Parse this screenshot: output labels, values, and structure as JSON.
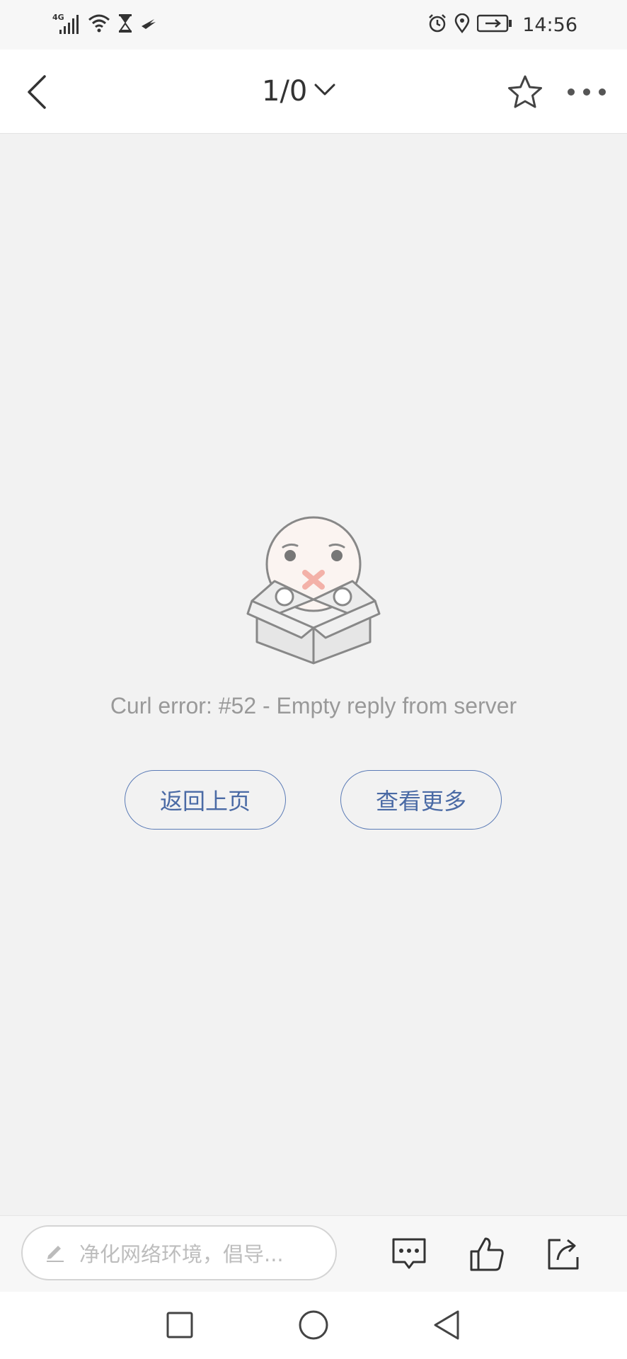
{
  "status_bar": {
    "network": "4G",
    "time": "14:56",
    "icons_left": [
      "signal-icon",
      "wifi-icon",
      "hourglass-icon",
      "bird-icon"
    ],
    "icons_right": [
      "alarm-icon",
      "location-icon",
      "battery-icon"
    ]
  },
  "nav": {
    "page_indicator": "1/0",
    "icons": [
      "back-arrow-icon",
      "chevron-down-icon",
      "star-icon",
      "more-icon"
    ]
  },
  "error": {
    "message": "Curl error: #52 - Empty reply from server",
    "illustration": "sad-face-in-box"
  },
  "buttons": {
    "back_page": "返回上页",
    "view_more": "查看更多"
  },
  "bottom_bar": {
    "input_placeholder": "净化网络环境，倡导...",
    "icons": [
      "pencil-icon",
      "comment-icon",
      "thumbs-up-icon",
      "share-icon"
    ]
  },
  "system_nav": {
    "icons": [
      "recent-apps-icon",
      "home-icon",
      "back-icon"
    ]
  },
  "colors": {
    "background": "#f2f2f2",
    "accent": "#4a6aa5",
    "error_text": "#999999"
  }
}
